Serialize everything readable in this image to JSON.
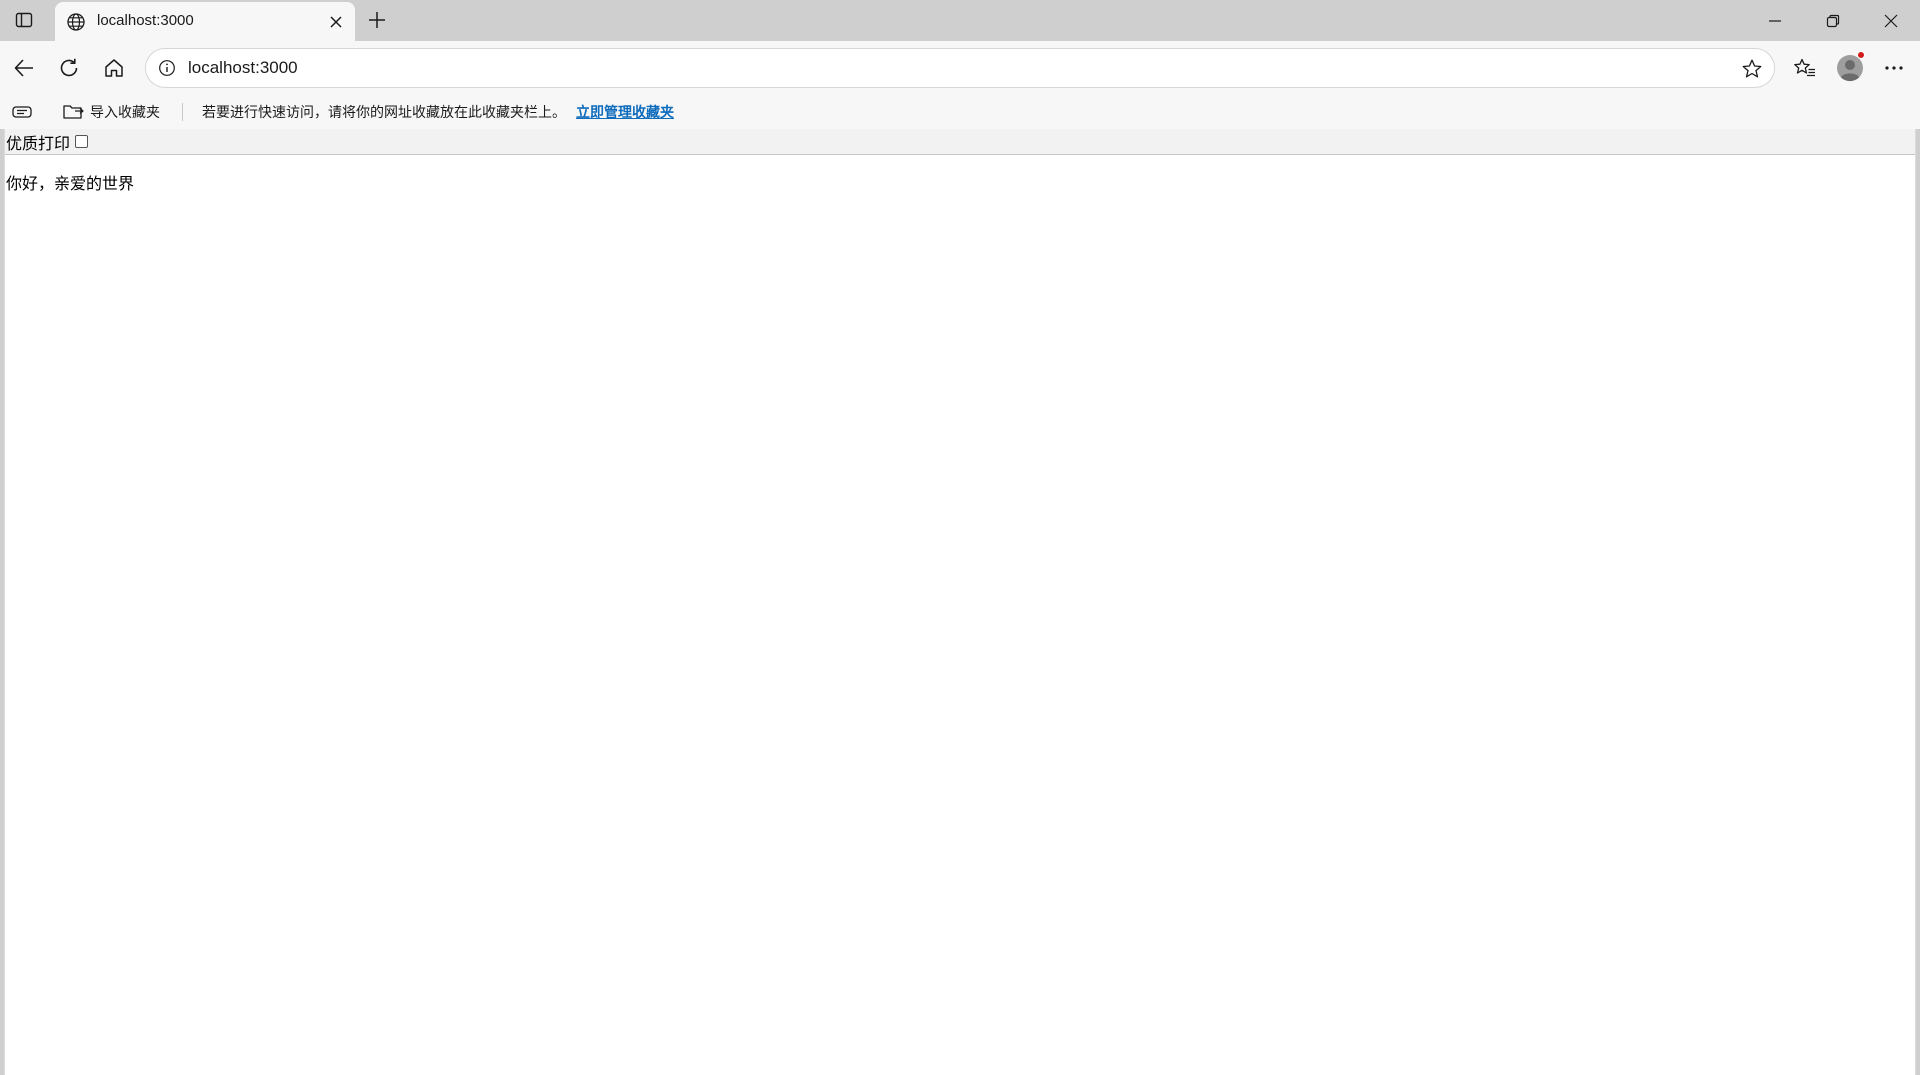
{
  "tabstrip": {
    "tab": {
      "title": "localhost:3000",
      "favicon": "globe-icon"
    },
    "new_tab_icon": "plus-icon",
    "tab_actions_icon": "tab-actions-icon"
  },
  "window_controls": {
    "minimize_icon": "minimize-icon",
    "restore_icon": "restore-icon",
    "close_icon": "close-icon"
  },
  "toolbar": {
    "address": "localhost:3000",
    "icons": [
      "back-icon",
      "refresh-icon",
      "home-icon",
      "info-icon",
      "star-icon",
      "favorites-icon",
      "profile-avatar",
      "more-icon"
    ]
  },
  "favorites_bar": {
    "import_label": "导入收藏夹",
    "hint": "若要进行快速访问，请将你的网址收藏放在此收藏夹栏上。",
    "manage_link": "立即管理收藏夹"
  },
  "page": {
    "print_label": "优质打印",
    "print_checked": false,
    "greeting": "你好，亲爱的世界"
  },
  "colors": {
    "chrome": "#cfcfcf",
    "toolbar": "#f7f7f7",
    "link": "#0f6cbd",
    "notification_dot": "#d21a1a"
  }
}
